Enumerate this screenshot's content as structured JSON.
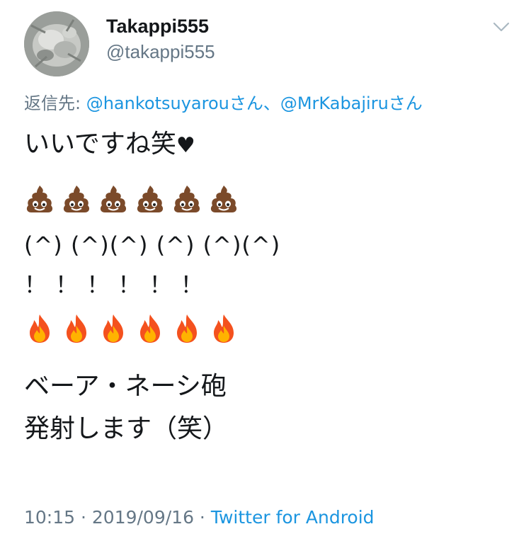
{
  "user": {
    "display_name": "Takappi555",
    "handle": "@takappi555"
  },
  "reply": {
    "prefix": "返信先: ",
    "mention1": "@hankotsuyarou",
    "suffix1": "さん、",
    "mention2": "@MrKabajiru",
    "suffix2": "さん"
  },
  "tweet": {
    "line1": "いいですね笑",
    "heart": "♥",
    "faces": "(^) (^)(^) (^) (^)(^)",
    "bangs": "！ ！ ！ ！ ！ ！",
    "line5": "ベーア・ネーシ砲",
    "line6": "発射します（笑）",
    "emoji_rows": [
      "pile-of-poo-icon x6",
      "fire-icon x6"
    ]
  },
  "meta": {
    "time": "10:15",
    "separator": " · ",
    "date": "2019/09/16",
    "source": "Twitter for Android"
  },
  "colors": {
    "text": "#14171a",
    "secondary": "#657786",
    "link": "#1b95e0"
  }
}
